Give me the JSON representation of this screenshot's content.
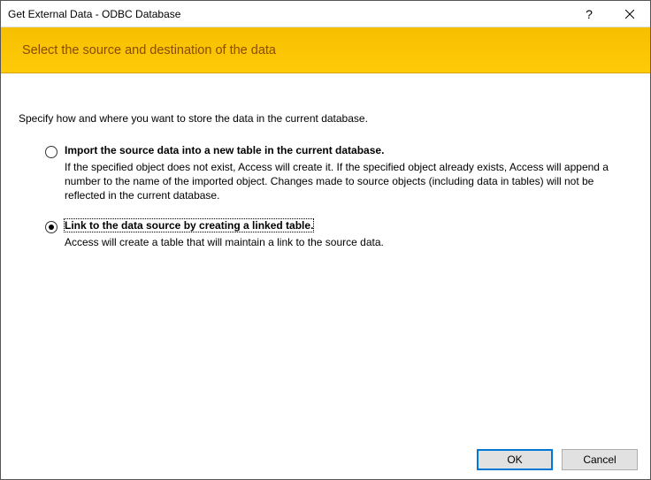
{
  "window": {
    "title": "Get External Data - ODBC Database"
  },
  "banner": {
    "title": "Select the source and destination of the data"
  },
  "intro": "Specify how and where you want to store the data in the current database.",
  "options": [
    {
      "label": "Import the source data into a new table in the current database.",
      "desc": "If the specified object does not exist, Access will create it. If the specified object already exists, Access will append a number to the name of the imported object. Changes made to source objects (including data in tables) will not be reflected in the current database.",
      "checked": false,
      "focused": false
    },
    {
      "label": "Link to the data source by creating a linked table.",
      "desc": "Access will create a table that will maintain a link to the source data.",
      "checked": true,
      "focused": true
    }
  ],
  "buttons": {
    "ok": "OK",
    "cancel": "Cancel"
  }
}
